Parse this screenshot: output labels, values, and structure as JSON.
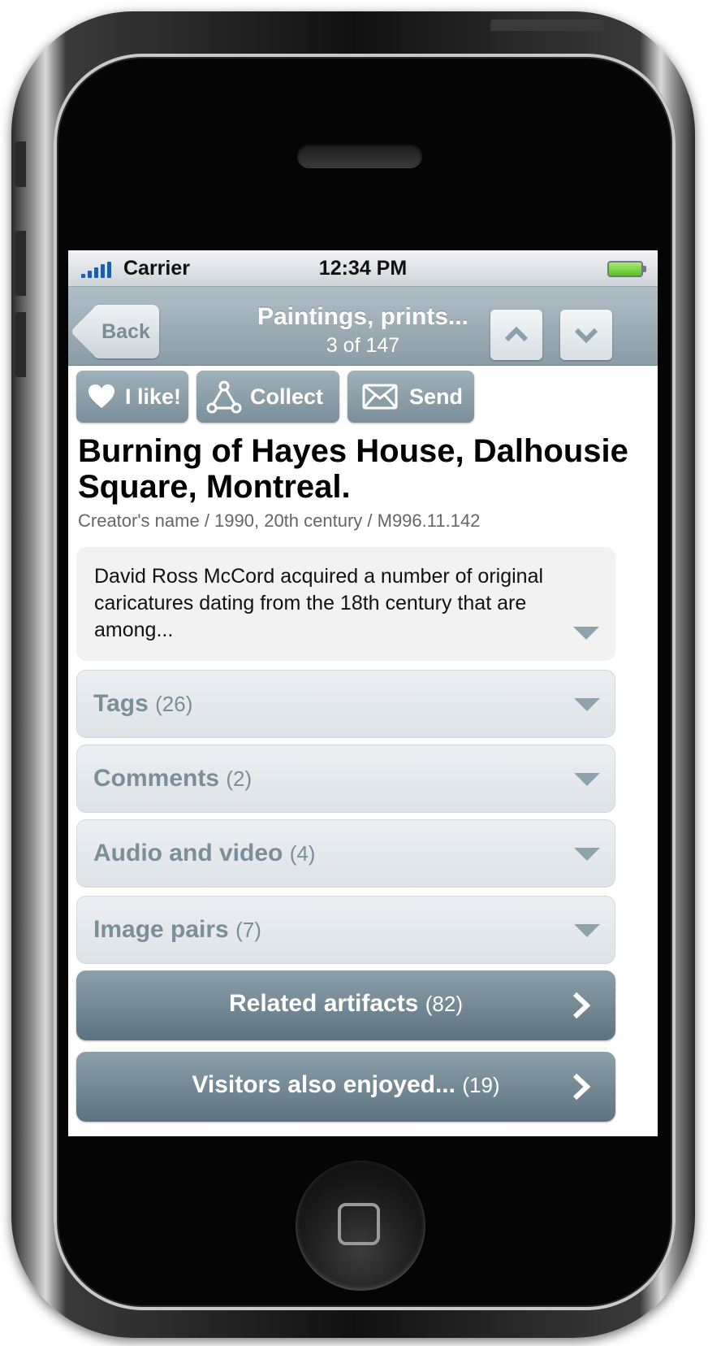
{
  "status_bar": {
    "carrier": "Carrier",
    "time": "12:34 PM"
  },
  "nav": {
    "back_label": "Back",
    "title": "Paintings, prints...",
    "subtitle": "3 of 147"
  },
  "actions": {
    "like": "I like!",
    "collect": "Collect",
    "send": "Send"
  },
  "artifact": {
    "title": "Burning of Hayes House, Dalhousie Square, Montreal.",
    "meta": "Creator's name / 1990, 20th century / M996.11.142",
    "description": "David Ross McCord acquired a number of original caricatures dating from the 18th century that are among..."
  },
  "sections": [
    {
      "title": "Tags",
      "count": "(26)"
    },
    {
      "title": "Comments",
      "count": "(2)"
    },
    {
      "title": "Audio and video",
      "count": "(4)"
    },
    {
      "title": "Image pairs",
      "count": "(7)"
    }
  ],
  "links": [
    {
      "title": "Related artifacts",
      "count": "(82)"
    },
    {
      "title": "Visitors also enjoyed...",
      "count": "(19)"
    }
  ],
  "colors": {
    "nav_bar": "#9aacb5",
    "section_text": "#7a8f98",
    "dark_button": "#6f8591",
    "accent_battery": "#5cbf2a"
  },
  "icons": [
    "signal-bars-icon",
    "battery-icon",
    "back-arrow-icon",
    "chevron-up-icon",
    "chevron-down-icon",
    "heart-icon",
    "collect-icon",
    "envelope-icon",
    "expand-caret-icon",
    "chevron-right-icon",
    "home-button-icon"
  ]
}
